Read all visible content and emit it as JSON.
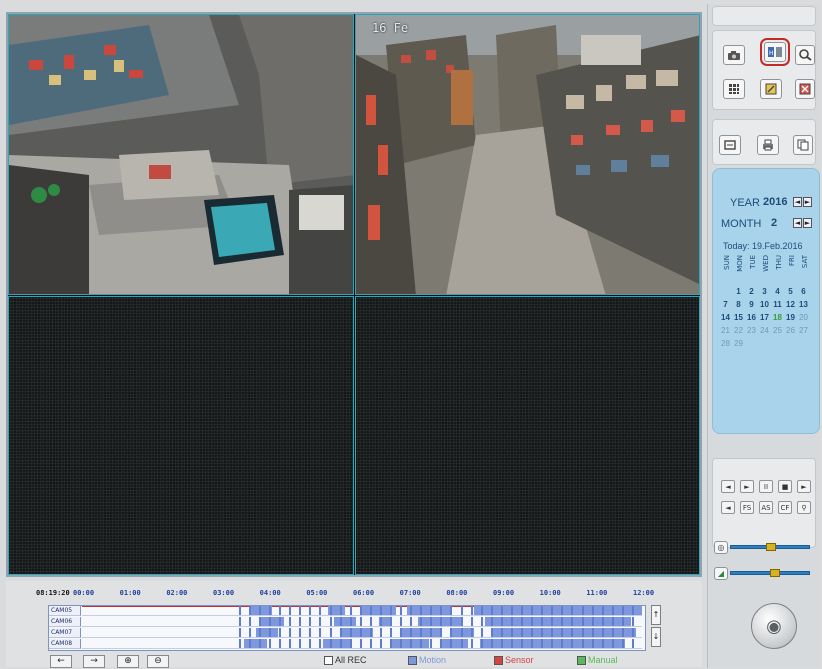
{
  "video": {
    "cam1_timestamp": "",
    "cam2_timestamp": "16 Fe"
  },
  "toolbar": {
    "row1_icons": [
      "camera-icon",
      "dual-screen-icon",
      "search-zoom-icon"
    ],
    "row2_icons": [
      "grid-icon",
      "note-icon",
      "close-box-icon"
    ],
    "row3_icons": [
      "export-icon",
      "print-icon",
      "copy-icon"
    ],
    "highlighted": "dual-screen-icon"
  },
  "calendar": {
    "year_label": "YEAR",
    "year": "2016",
    "month_label": "MONTH",
    "month": "2",
    "today": "Today: 19.Feb.2016",
    "weekdays": [
      "SUN",
      "MON",
      "TUE",
      "WED",
      "THU",
      "FRI",
      "SAT"
    ],
    "weeks": [
      [
        "",
        "1",
        "2",
        "3",
        "4",
        "5",
        "6"
      ],
      [
        "7",
        "8",
        "9",
        "10",
        "11",
        "12",
        "13"
      ],
      [
        "14",
        "15",
        "16",
        "17",
        "18",
        "19",
        "20"
      ],
      [
        "21",
        "22",
        "23",
        "24",
        "25",
        "26",
        "27"
      ],
      [
        "28",
        "29",
        "",
        "",
        "",
        "",
        ""
      ]
    ],
    "selected_day": "18",
    "muted_from": "20"
  },
  "playback": {
    "row1": [
      "◄",
      "►",
      "II",
      "■",
      "►"
    ],
    "row2": [
      "◄",
      "FS",
      "AS",
      "CF",
      "⚲"
    ]
  },
  "sliders": [
    {
      "name": "speed",
      "level": 0.5
    },
    {
      "name": "volume",
      "level": 0.55
    }
  ],
  "timeline": {
    "current_time": "08:19:20",
    "hours": [
      "00:00",
      "01:00",
      "02:00",
      "03:00",
      "04:00",
      "05:00",
      "06:00",
      "07:00",
      "08:00",
      "09:00",
      "10:00",
      "11:00",
      "12:00"
    ],
    "cameras": [
      "CAM05",
      "CAM06",
      "CAM07",
      "CAM08"
    ],
    "nav": [
      "←",
      "→",
      "⊕",
      "⊖"
    ],
    "legend": [
      {
        "label": "All REC",
        "color": "#ffffff"
      },
      {
        "label": "Motion",
        "color": "#7f98dd"
      },
      {
        "label": "Sensor",
        "color": "#d64343"
      },
      {
        "label": "Manual",
        "color": "#5cb85c"
      }
    ]
  }
}
